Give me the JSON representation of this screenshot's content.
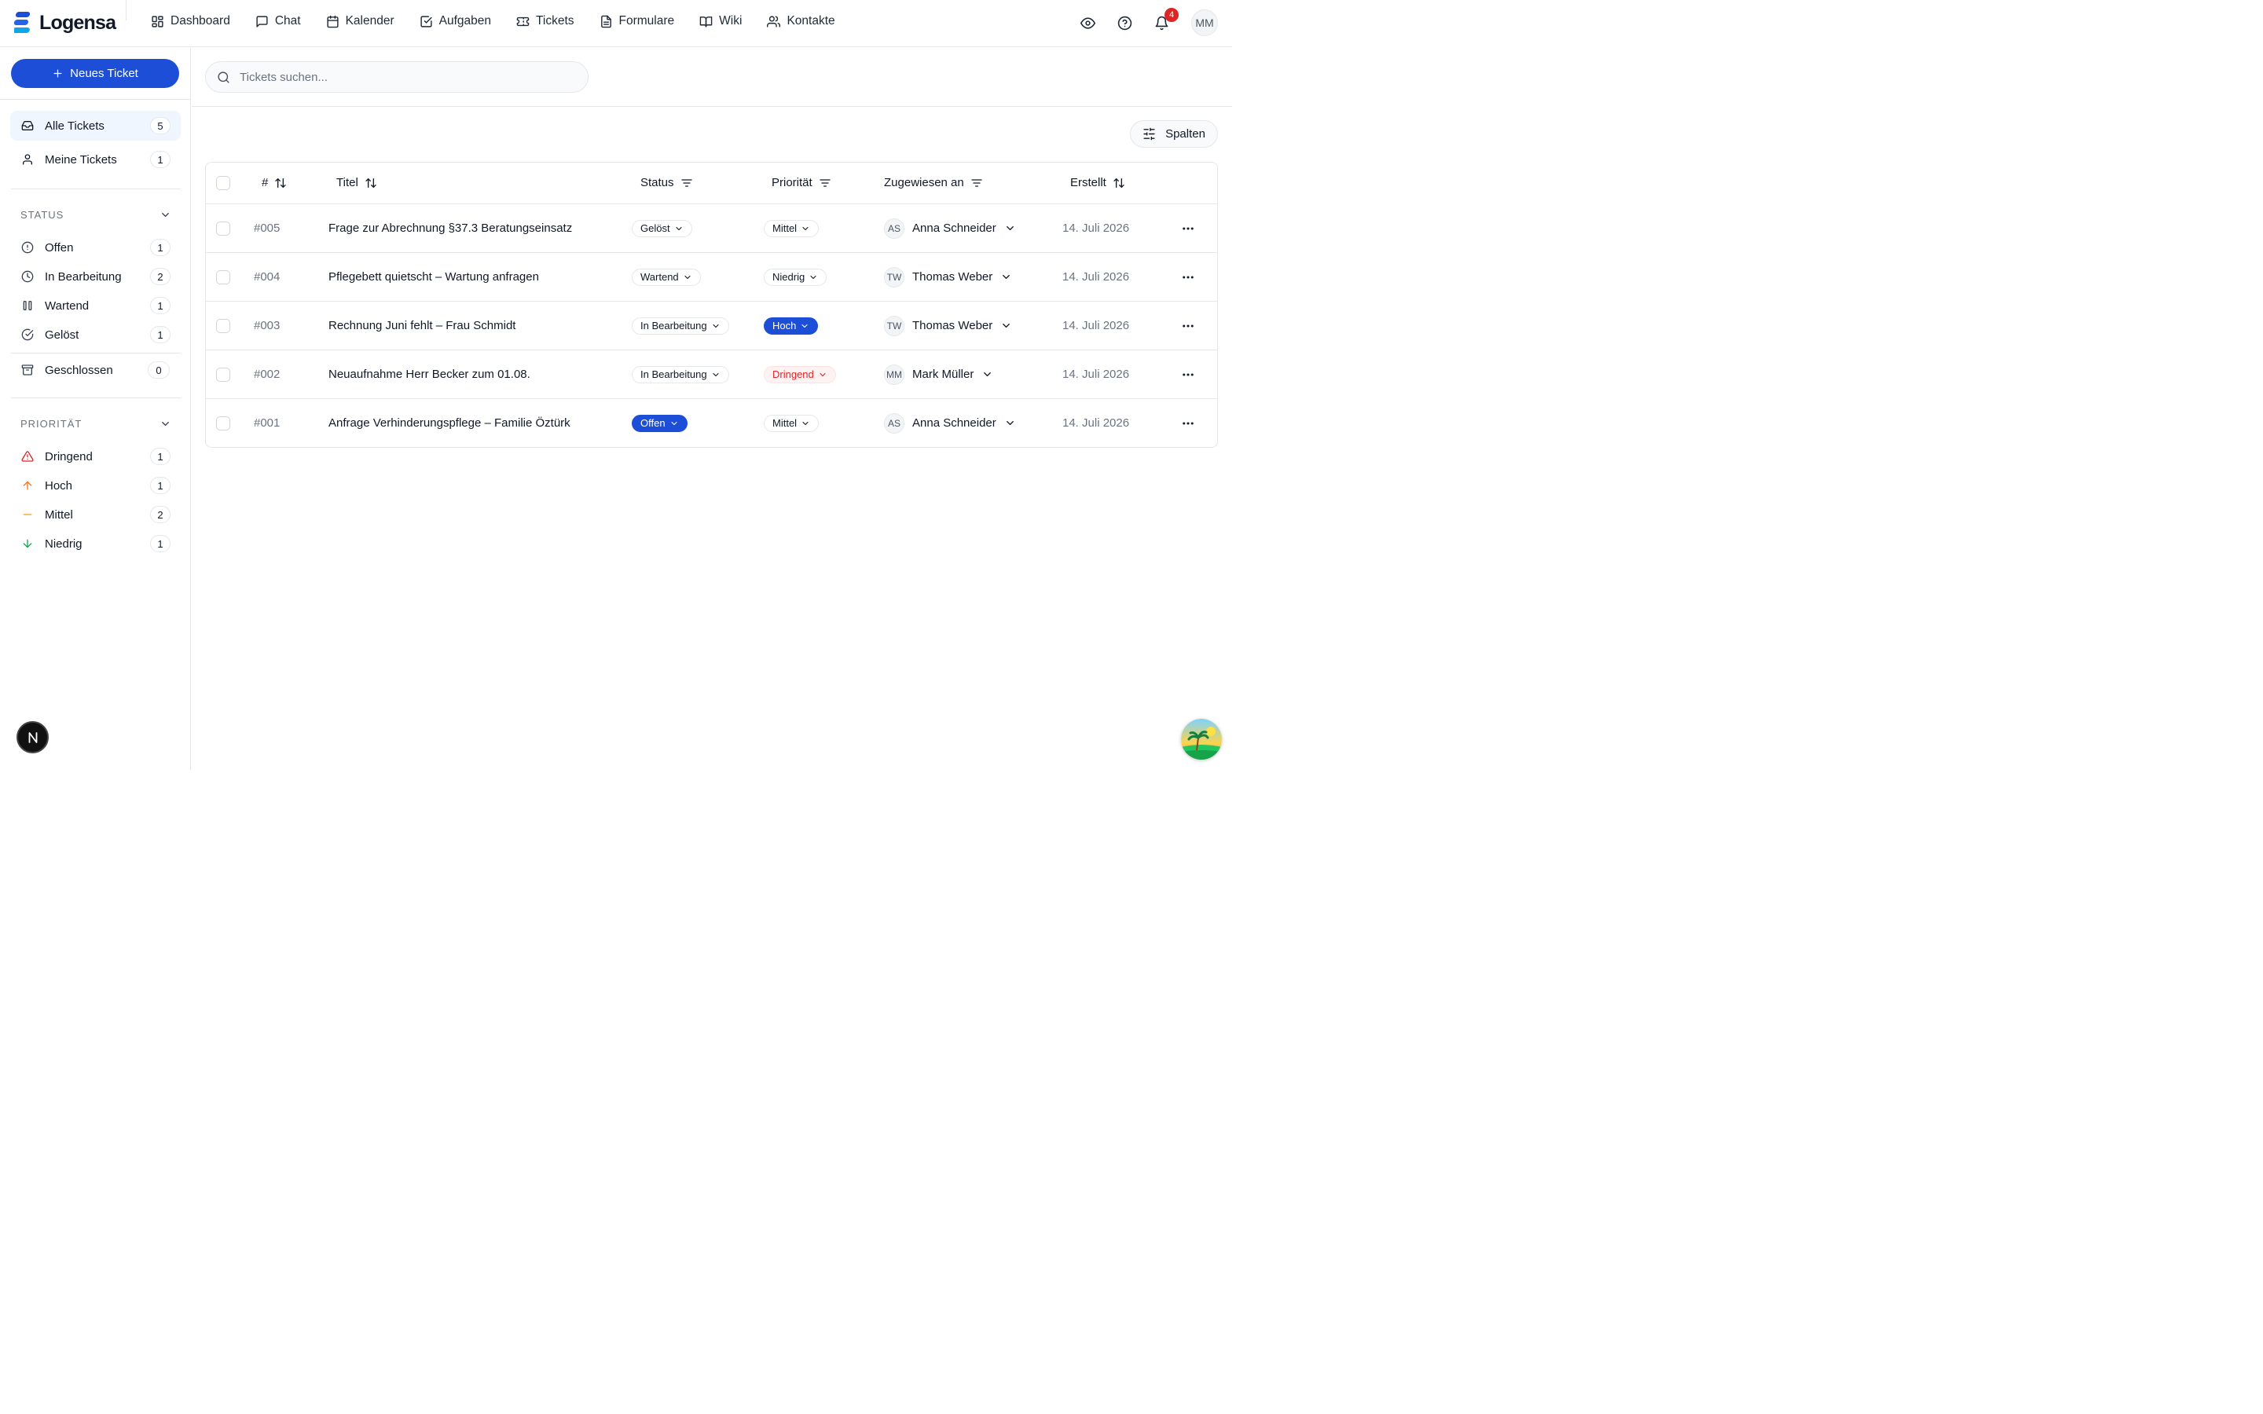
{
  "app": {
    "logo_text": "Logensa"
  },
  "nav": {
    "items": [
      {
        "label": "Dashboard",
        "icon": "dashboard-icon"
      },
      {
        "label": "Chat",
        "icon": "chat-icon"
      },
      {
        "label": "Kalender",
        "icon": "calendar-icon"
      },
      {
        "label": "Aufgaben",
        "icon": "checkbox-icon"
      },
      {
        "label": "Tickets",
        "icon": "ticket-icon"
      },
      {
        "label": "Formulare",
        "icon": "document-icon"
      },
      {
        "label": "Wiki",
        "icon": "book-icon"
      },
      {
        "label": "Kontakte",
        "icon": "users-icon"
      }
    ],
    "notifications_count": "4",
    "user_initials": "MM"
  },
  "sidebar": {
    "new_ticket_label": "Neues Ticket",
    "views": [
      {
        "label": "Alle Tickets",
        "count": "5"
      },
      {
        "label": "Meine Tickets",
        "count": "1"
      }
    ],
    "status_title": "STATUS",
    "status_items": [
      {
        "label": "Offen",
        "count": "1"
      },
      {
        "label": "In Bearbeitung",
        "count": "2"
      },
      {
        "label": "Wartend",
        "count": "1"
      },
      {
        "label": "Gelöst",
        "count": "1"
      },
      {
        "label": "Geschlossen",
        "count": "0"
      }
    ],
    "priority_title": "PRIORITÄT",
    "priority_items": [
      {
        "label": "Dringend",
        "count": "1"
      },
      {
        "label": "Hoch",
        "count": "1"
      },
      {
        "label": "Mittel",
        "count": "2"
      },
      {
        "label": "Niedrig",
        "count": "1"
      }
    ],
    "bottom_button": "N"
  },
  "search": {
    "placeholder": "Tickets suchen..."
  },
  "toolbar": {
    "columns_label": "Spalten"
  },
  "table": {
    "headers": {
      "id": "#",
      "title": "Titel",
      "status": "Status",
      "priority": "Priorität",
      "assignee": "Zugewiesen an",
      "created": "Erstellt"
    },
    "rows": [
      {
        "id": "#005",
        "title": "Frage zur Abrechnung §37.3 Beratungseinsatz",
        "status": "Gelöst",
        "priority": "Mittel",
        "assignee_initials": "AS",
        "assignee": "Anna Schneider",
        "created": "14. Juli 2026"
      },
      {
        "id": "#004",
        "title": "Pflegebett quietscht – Wartung anfragen",
        "status": "Wartend",
        "priority": "Niedrig",
        "assignee_initials": "TW",
        "assignee": "Thomas Weber",
        "created": "14. Juli 2026"
      },
      {
        "id": "#003",
        "title": "Rechnung Juni fehlt – Frau Schmidt",
        "status": "In Bearbeitung",
        "priority": "Hoch",
        "assignee_initials": "TW",
        "assignee": "Thomas Weber",
        "created": "14. Juli 2026"
      },
      {
        "id": "#002",
        "title": "Neuaufnahme Herr Becker zum 01.08.",
        "status": "In Bearbeitung",
        "priority": "Dringend",
        "assignee_initials": "MM",
        "assignee": "Mark Müller",
        "created": "14. Juli 2026"
      },
      {
        "id": "#001",
        "title": "Anfrage Verhinderungspflege – Familie Öztürk",
        "status": "Offen",
        "priority": "Mittel",
        "assignee_initials": "AS",
        "assignee": "Anna Schneider",
        "created": "14. Juli 2026"
      }
    ]
  },
  "colors": {
    "accent": "#1d4ed8",
    "danger": "#dc2626",
    "high": "#f97316",
    "medium": "#f59e0b",
    "low": "#16a34a"
  }
}
